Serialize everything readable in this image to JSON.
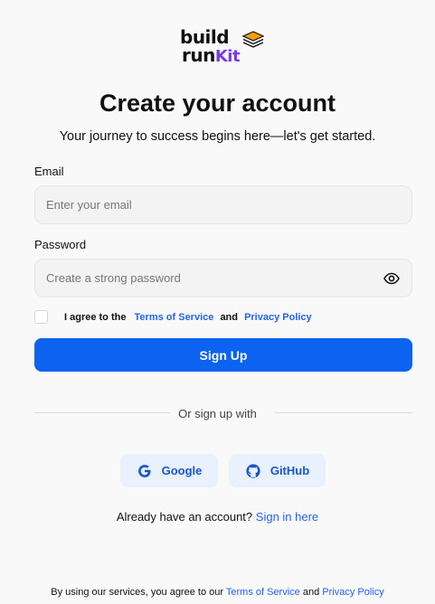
{
  "brand": {
    "line1": "build",
    "line2_prefix": "run",
    "line2_accent": "Kit"
  },
  "header": {
    "title": "Create your account",
    "subtitle": "Your journey to success begins here—let's get started."
  },
  "form": {
    "email_label": "Email",
    "email_placeholder": "Enter your email",
    "email_value": "",
    "password_label": "Password",
    "password_placeholder": "Create a strong password",
    "password_value": "",
    "agree_prefix": "I agree to the",
    "terms_link": "Terms of Service",
    "agree_and": "and",
    "privacy_link": "Privacy Policy",
    "agree_checked": false,
    "submit_label": "Sign Up"
  },
  "social": {
    "divider_text": "Or sign up with",
    "google_label": "Google",
    "github_label": "GitHub"
  },
  "signin": {
    "prompt": "Already have an account?",
    "link": "Sign in here"
  },
  "footer": {
    "prefix": "By using our services, you agree to our",
    "terms_link": "Terms of Service",
    "and": "and",
    "privacy_link": "Privacy Policy"
  },
  "icons": {
    "logo": "layers-icon",
    "eye": "eye-icon",
    "google": "google-icon",
    "github": "github-icon"
  },
  "colors": {
    "primary": "#0b63f0",
    "link": "#2563eb",
    "social_bg": "#e8f1fc",
    "brand_accent": "#7c3aed",
    "background": "#f9f9f9"
  }
}
